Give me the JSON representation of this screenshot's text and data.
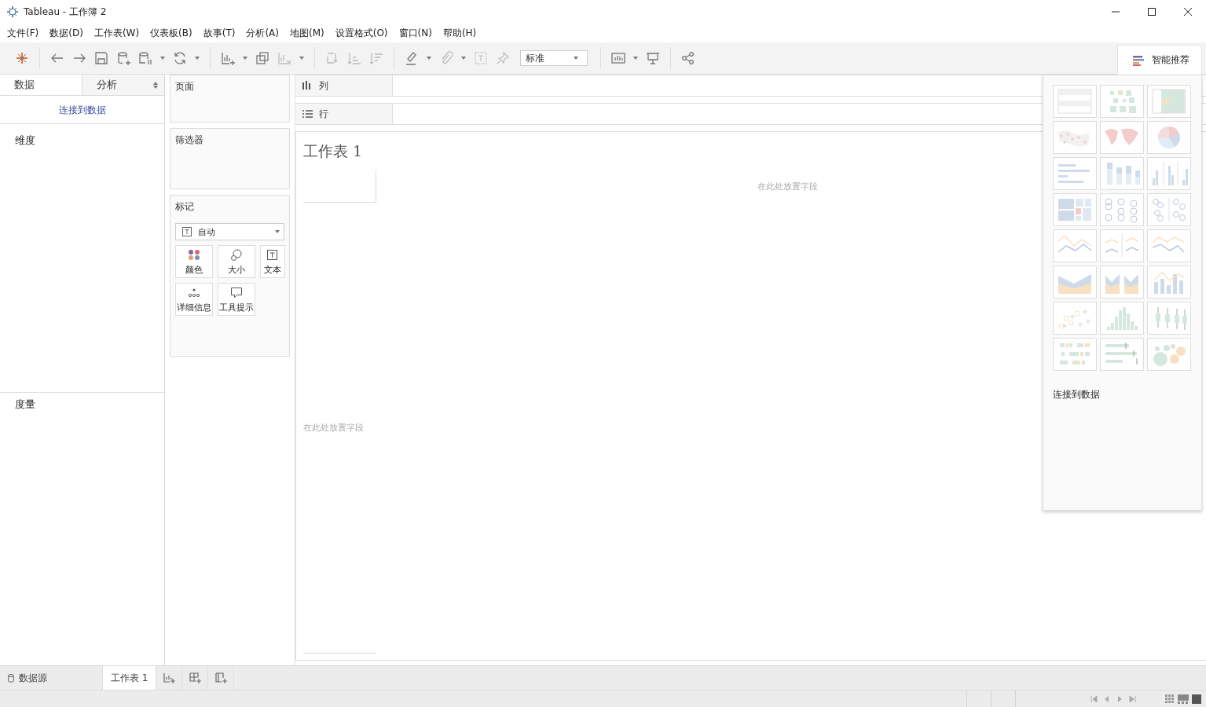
{
  "window": {
    "title": "Tableau - 工作簿 2"
  },
  "menu": [
    "文件(F)",
    "数据(D)",
    "工作表(W)",
    "仪表板(B)",
    "故事(T)",
    "分析(A)",
    "地图(M)",
    "设置格式(O)",
    "窗口(N)",
    "帮助(H)"
  ],
  "toolbar": {
    "fit_dropdown": "标准",
    "show_me_button": "智能推荐"
  },
  "data_pane": {
    "tabs": [
      {
        "label": "数据",
        "selected": true
      },
      {
        "label": "分析",
        "selected": false
      }
    ],
    "connect_link": "连接到数据",
    "sections": [
      "维度",
      "度量"
    ]
  },
  "cards": {
    "pages": "页面",
    "filters": "筛选器",
    "marks": {
      "title": "标记",
      "mark_type": "自动",
      "buttons": [
        {
          "label": "颜色",
          "kind": "color"
        },
        {
          "label": "大小",
          "kind": "size"
        },
        {
          "label": "文本",
          "kind": "text"
        },
        {
          "label": "详细信息",
          "kind": "detail"
        },
        {
          "label": "工具提示",
          "kind": "tooltip"
        }
      ]
    }
  },
  "shelves": [
    {
      "label": "列",
      "kind": "columns"
    },
    {
      "label": "行",
      "kind": "rows"
    }
  ],
  "sheet": {
    "title": "工作表 1",
    "drop_hints": [
      "在此处放置字段",
      "在此处放置字段"
    ]
  },
  "show_me": {
    "charts": [
      {
        "kind": "text-table"
      },
      {
        "kind": "heat-map"
      },
      {
        "kind": "highlight-table"
      },
      {
        "kind": "symbol-map"
      },
      {
        "kind": "filled-map"
      },
      {
        "kind": "pie"
      },
      {
        "kind": "horizontal-bars"
      },
      {
        "kind": "stacked-bars"
      },
      {
        "kind": "side-by-side-bars"
      },
      {
        "kind": "treemap"
      },
      {
        "kind": "circle-view"
      },
      {
        "kind": "side-by-side-circles"
      },
      {
        "kind": "continuous-lines"
      },
      {
        "kind": "discrete-lines"
      },
      {
        "kind": "dual-lines"
      },
      {
        "kind": "continuous-area"
      },
      {
        "kind": "discrete-area"
      },
      {
        "kind": "dual-combination"
      },
      {
        "kind": "scatter"
      },
      {
        "kind": "histogram"
      },
      {
        "kind": "box-plot"
      },
      {
        "kind": "gantt"
      },
      {
        "kind": "bullet"
      },
      {
        "kind": "packed-bubbles"
      }
    ],
    "connect_link": "连接到数据"
  },
  "sheet_tabs": [
    {
      "label": "数据源",
      "kind": "data-source",
      "selected": false
    },
    {
      "label": "工作表 1",
      "kind": "sheet",
      "selected": true
    }
  ]
}
